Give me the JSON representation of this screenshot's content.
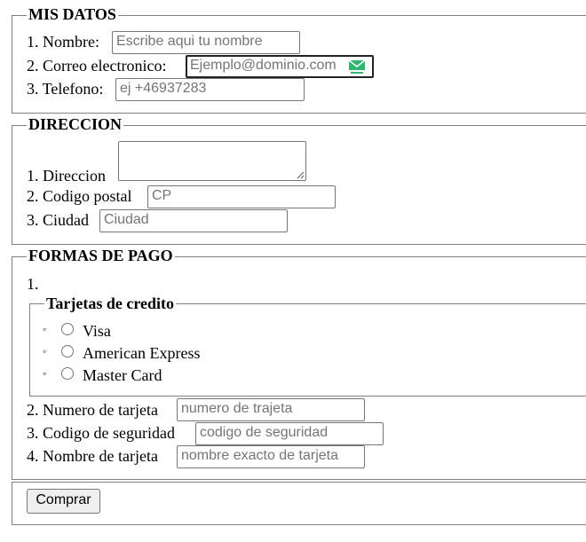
{
  "mis_datos": {
    "legend": "MIS DATOS",
    "fields": [
      {
        "label": "1. Nombre:",
        "placeholder": "Escribe aqui tu nombre"
      },
      {
        "label": "2. Correo electronico:",
        "placeholder": "Ejemplo@dominio.com"
      },
      {
        "label": "3. Telefono:",
        "placeholder": "ej +46937283"
      }
    ]
  },
  "direccion": {
    "legend": "DIRECCION",
    "fields": [
      {
        "label": "1. Direccion"
      },
      {
        "label": "2. Codigo postal",
        "placeholder": "CP"
      },
      {
        "label": "3. Ciudad",
        "placeholder": "Ciudad"
      }
    ]
  },
  "formas_de_pago": {
    "legend": "FORMAS DE PAGO",
    "item1_marker": "1.",
    "tarjetas": {
      "legend": "Tarjetas de credito",
      "bullet": "◦",
      "options": [
        "Visa",
        "American Express",
        "Master Card"
      ]
    },
    "fields": [
      {
        "label": "2. Numero de tarjeta",
        "placeholder": "numero de trajeta"
      },
      {
        "label": "3. Codigo de seguridad",
        "placeholder": "codigo de seguridad"
      },
      {
        "label": "4. Nombre de tarjeta",
        "placeholder": "nombre exacto de tarjeta"
      }
    ]
  },
  "submit": {
    "label": "Comprar"
  },
  "icons": {
    "email_autofill": "email-extension-icon"
  },
  "colors": {
    "border": "#808080",
    "placeholder": "#757575",
    "icon_green": "#2fb673"
  }
}
